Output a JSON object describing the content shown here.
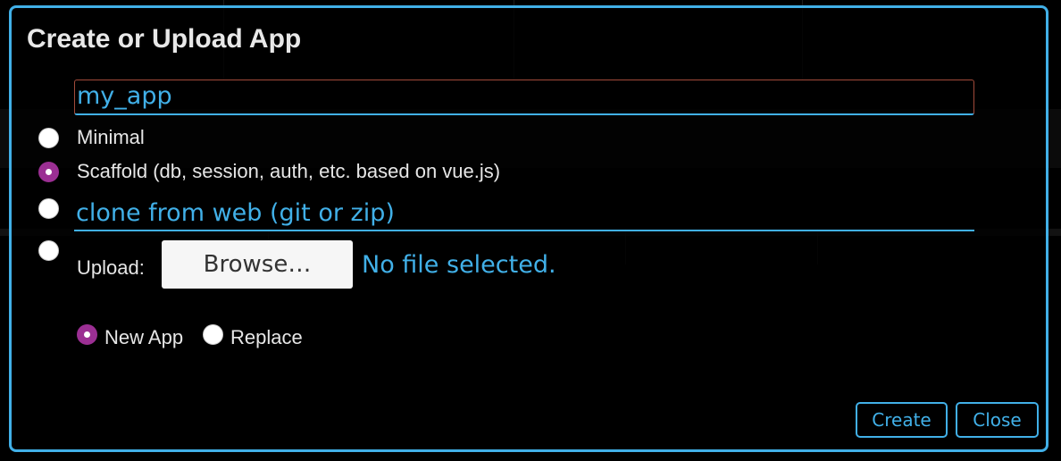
{
  "dialog": {
    "title": "Create or Upload App",
    "app_name_value": "my_app",
    "options": {
      "minimal_label": "Minimal",
      "scaffold_label": "Scaffold (db, session, auth, etc. based on vue.js)",
      "clone_placeholder": "clone from web (git or zip)",
      "upload_label": "Upload:"
    },
    "selected_option": "scaffold",
    "browse_label": "Browse…",
    "file_status": "No file selected.",
    "mode": {
      "new_app_label": "New App",
      "replace_label": "Replace",
      "selected": "new_app"
    },
    "create_label": "Create",
    "close_label": "Close"
  },
  "colors": {
    "accent": "#41b0e8",
    "radio_checked": "#9b2f93",
    "input_border": "#a24a3a"
  }
}
